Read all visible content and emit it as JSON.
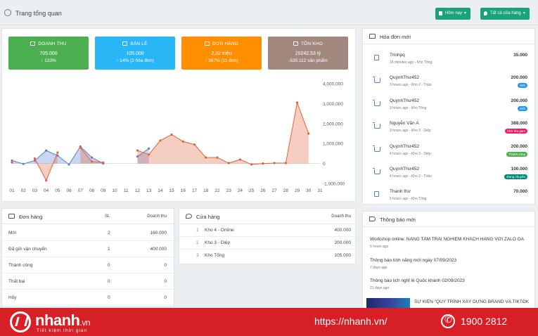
{
  "header": {
    "title": "Trang tổng quan",
    "date_filter": "Hôm nay",
    "store_filter": "Tất cả cửa hàng"
  },
  "stats": [
    {
      "label": "DOANH THU",
      "value": "705.000",
      "sub": "↑ 133%",
      "color": "#4caf50",
      "icon": "chart-icon"
    },
    {
      "label": "BÁN LẺ",
      "value": "105.000",
      "sub": "↑ 14% (2 hóa đơn)",
      "color": "#29b6f6",
      "icon": "bag-icon"
    },
    {
      "label": "ĐƠN HÀNG",
      "value": "2,32 triệu",
      "sub": "↑ 367% (11 đơn)",
      "color": "#ff8f00",
      "icon": "cart-icon"
    },
    {
      "label": "TỒN KHO",
      "value": "20242,53 tỷ",
      "sub": "-535.112 sản phẩm",
      "color": "#a1887f",
      "icon": "box-icon"
    }
  ],
  "chart_data": {
    "type": "area",
    "categories": [
      "01",
      "02",
      "03",
      "04",
      "05",
      "06",
      "07",
      "08",
      "09",
      "10",
      "11",
      "12",
      "13",
      "14",
      "15",
      "16",
      "17",
      "18",
      "22",
      "23",
      "24",
      "25",
      "26",
      "27",
      "28",
      "29",
      "30",
      "31"
    ],
    "y_ticks": [
      "4,000,000",
      "3,000,000",
      "2,000,000",
      "1,000,000",
      "0",
      "-1,000,000"
    ],
    "ylim": [
      -1000000,
      4000000
    ],
    "series": [
      {
        "color": "#5b7fd1",
        "values": [
          150000,
          -20000,
          150000,
          650000,
          400000,
          -50000,
          850000,
          300000,
          0,
          null,
          null,
          350000,
          750000,
          null,
          null,
          null,
          null,
          null,
          null,
          null,
          null,
          null,
          null,
          null,
          null,
          null,
          null,
          null
        ]
      },
      {
        "color": "#e0623d",
        "values": [
          50000,
          null,
          250000,
          -850000,
          550000,
          null,
          800000,
          100000,
          50000,
          null,
          null,
          650000,
          450000,
          1150000,
          1450000,
          1100000,
          950000,
          300000,
          300000,
          20000,
          200000,
          -50000,
          0,
          20000,
          20000,
          3050000,
          1500000,
          null
        ]
      }
    ]
  },
  "orders": {
    "title": "Đơn hàng",
    "col_qty": "SL",
    "col_revenue": "Doanh thu",
    "rows": [
      {
        "name": "Mới",
        "qty": "2",
        "revenue": "160.000"
      },
      {
        "name": "Đã gửi vận chuyển",
        "qty": "1",
        "revenue": "400.000"
      },
      {
        "name": "Thành công",
        "qty": "0",
        "revenue": "0"
      },
      {
        "name": "Thất bại",
        "qty": "0",
        "revenue": "0"
      },
      {
        "name": "Hủy",
        "qty": "0",
        "revenue": "0"
      }
    ]
  },
  "stores": {
    "title": "Cửa hàng",
    "col_revenue": "Doanh thu",
    "rows": [
      {
        "idx": "1",
        "name": "Kho 4 - Online",
        "revenue": "400.000"
      },
      {
        "idx": "2",
        "name": "Kho 3 - Diệp",
        "revenue": "200.000"
      },
      {
        "idx": "3",
        "name": "Kho Tổng",
        "revenue": "105.000"
      }
    ]
  },
  "invoices": {
    "title": "Hóa đơn mới",
    "items": [
      {
        "icon": "bag-icon",
        "name": "Trinhpq",
        "meta": "15 minutes ago - Kho Tổng",
        "amount": "35.000",
        "badge": "",
        "badge_color": ""
      },
      {
        "icon": "cart-icon",
        "name": "QuỳnhThư452",
        "meta": "3 hours ago - Kho 2 - Thảo",
        "amount": "200.000",
        "badge": "Mới",
        "badge_color": "#2196f3"
      },
      {
        "icon": "cart-icon",
        "name": "QuỳnhThư452",
        "meta": "3 hours ago - Kho Tổng",
        "amount": "200.000",
        "badge": "Mới",
        "badge_color": "#2196f3"
      },
      {
        "icon": "cart-icon",
        "name": "Nguyễn Văn A",
        "meta": "3 hours ago - Kho 3 - Diệp",
        "amount": "388.000",
        "badge": "Chờ thu gom",
        "badge_color": "#e91e63"
      },
      {
        "icon": "cart-icon",
        "name": "QuỳnhThư452",
        "meta": "4 hours ago - Kho 3 - Diệp",
        "amount": "200.000",
        "badge": "Thành công",
        "badge_color": "#4caf50"
      },
      {
        "icon": "cart-icon",
        "name": "QuỳnhThư452",
        "meta": "4 hours ago - Kho 2 - Thảo",
        "amount": "100.000",
        "badge": "Đang chuyển",
        "badge_color": "#00897b"
      },
      {
        "icon": "bag-icon",
        "name": "Thanh thư",
        "meta": "5 hours ago - Kho Tổng",
        "amount": "70.000",
        "badge": "",
        "badge_color": ""
      }
    ]
  },
  "notices": {
    "title": "Thông báo mới",
    "items": [
      {
        "text": "Workshop online: NÂNG TẦM TRẢI NGHIỆM KHÁCH HÀNG VỚI ZALO OA",
        "time": "5 hours ago"
      },
      {
        "text": "Thông báo tính năng mới ngày 07/09/2023",
        "time": "7 days ago"
      },
      {
        "text": "Thông báo lịch nghỉ lễ Quốc khánh 02/09/2023",
        "time": "21 days ago"
      },
      {
        "text": "SỰ KIỆN \"QUY TRÌNH XÂY DỰNG BRAND VÀ TIKTOK",
        "time": ""
      }
    ]
  },
  "banner": {
    "brand": "nhanh",
    "brand_domain": ".vn",
    "slogan": "Tiết kiệm thời gian",
    "url": "https://nhanh.vn/",
    "phone": "1900 2812"
  }
}
